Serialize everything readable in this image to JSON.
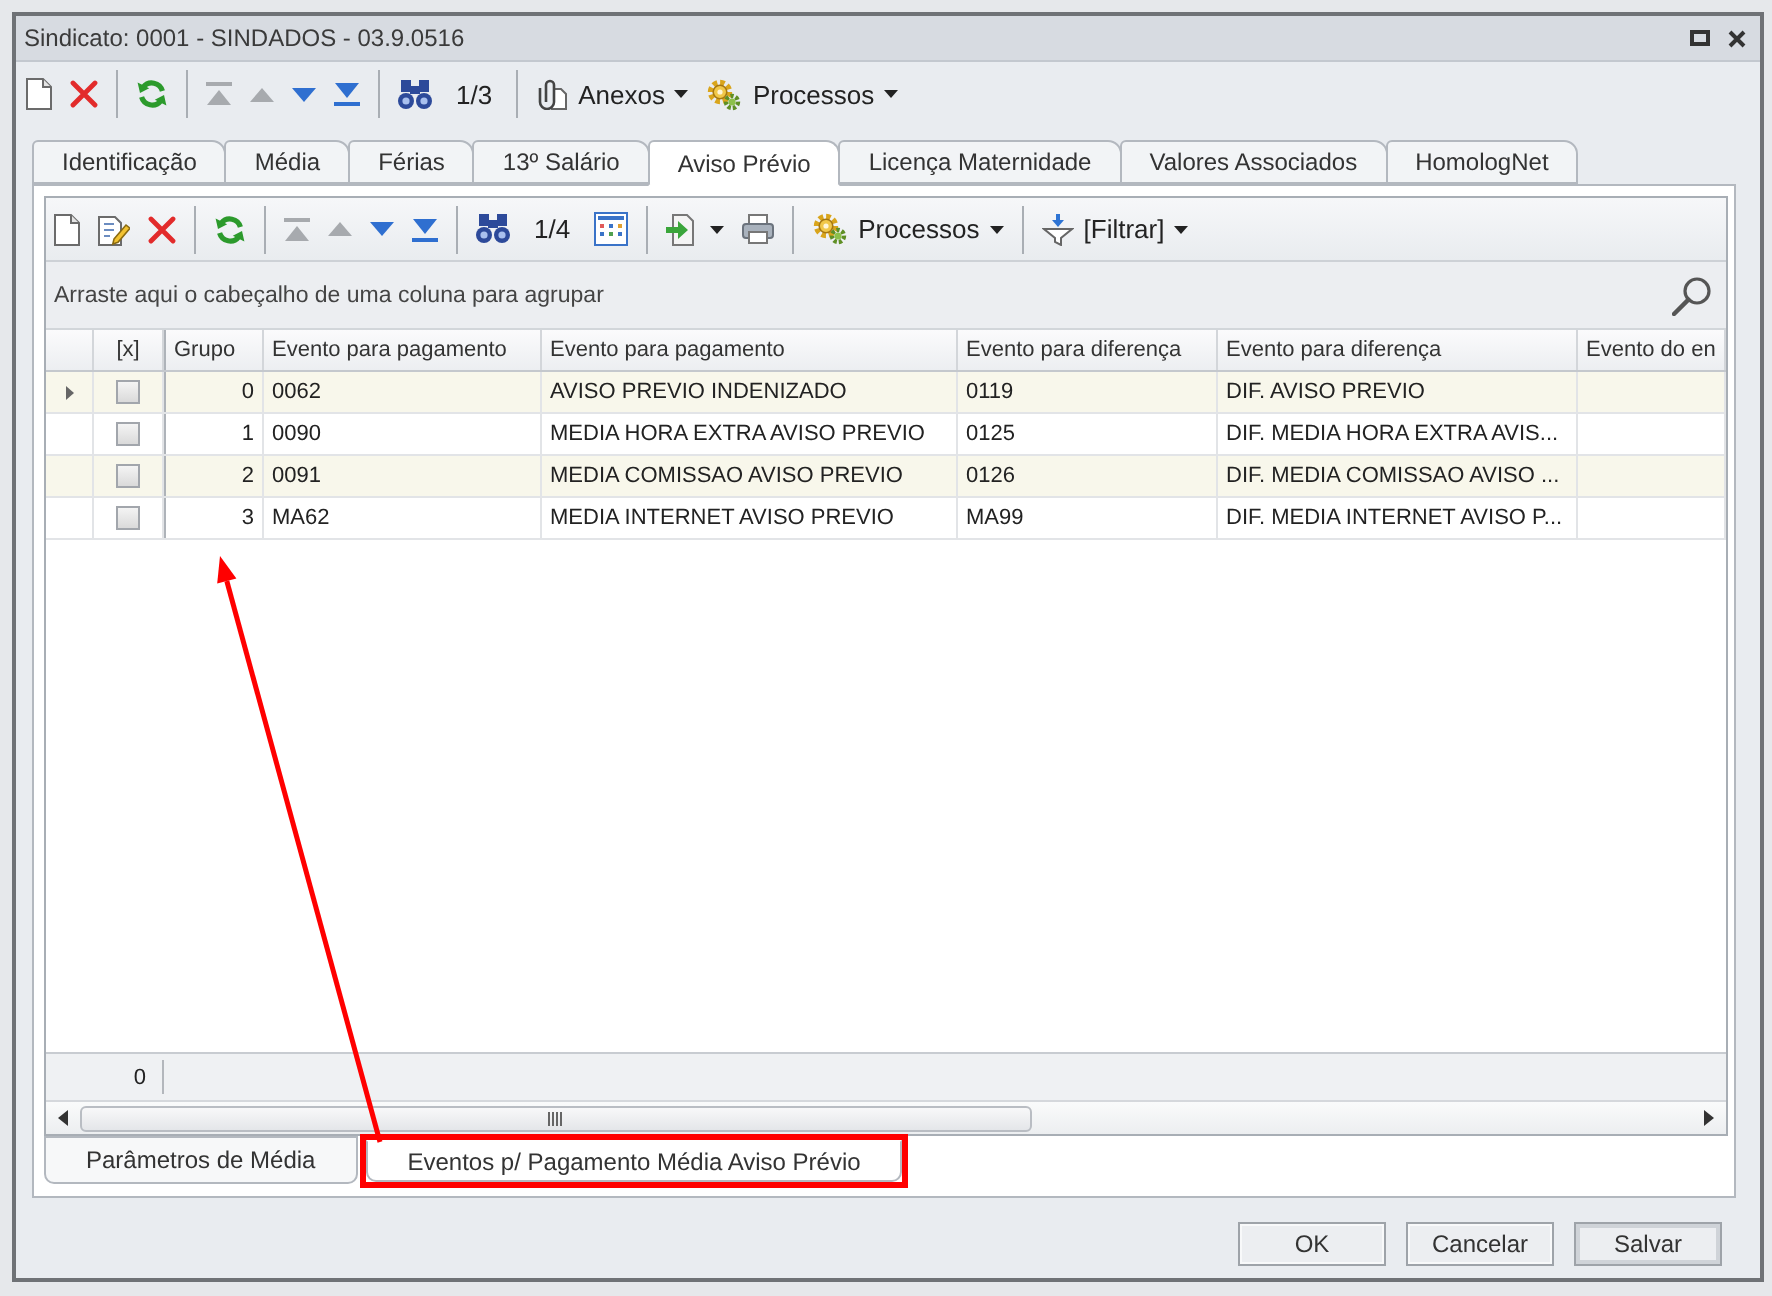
{
  "window": {
    "title": "Sindicato: 0001 - SINDADOS - 03.9.0516"
  },
  "toolbar": {
    "navigation": [
      {
        "disabled": true
      },
      {
        "disabled": true
      },
      {
        "disabled": false
      },
      {
        "disabled": false
      }
    ],
    "record_counter": "1/3",
    "attachments": {
      "label": "Anexos"
    },
    "processes": {
      "label": "Processos"
    }
  },
  "tabs": [
    {
      "label": "Identificação",
      "selected": false
    },
    {
      "label": "Média",
      "selected": false
    },
    {
      "label": "Férias",
      "selected": false
    },
    {
      "label": "13º Salário",
      "selected": false
    },
    {
      "label": "Aviso Prévio",
      "selected": true
    },
    {
      "label": "Licença Maternidade",
      "selected": false
    },
    {
      "label": "Valores Associados",
      "selected": false
    },
    {
      "label": "HomologNet",
      "selected": false
    }
  ],
  "grid_toolbar": {
    "navigation": [
      {
        "disabled": true
      },
      {
        "disabled": true
      },
      {
        "disabled": false
      },
      {
        "disabled": false
      }
    ],
    "record_counter": "1/4",
    "processes": {
      "label": "Processos"
    },
    "filter": {
      "label": "[Filtrar]"
    }
  },
  "group_panel": {
    "hint": "Arraste aqui o cabeçalho de uma coluna para agrupar"
  },
  "table": {
    "check_column": {
      "label": "[x]"
    },
    "columns": [
      {
        "label": "Grupo",
        "kind": "number"
      },
      {
        "label": "Evento para pagamento",
        "kind": "text"
      },
      {
        "label": "Evento para pagamento",
        "kind": "text"
      },
      {
        "label": "Evento para diferença",
        "kind": "text"
      },
      {
        "label": "Evento para diferença",
        "kind": "text"
      },
      {
        "label": "Evento do en",
        "kind": "text"
      }
    ],
    "rows": [
      {
        "selected": true,
        "checked": false,
        "cells": [
          "0",
          "0062",
          "AVISO PREVIO INDENIZADO",
          "0119",
          "DIF. AVISO PREVIO"
        ]
      },
      {
        "selected": false,
        "checked": false,
        "cells": [
          "1",
          "0090",
          "MEDIA HORA EXTRA AVISO PREVIO",
          "0125",
          "DIF. MEDIA HORA EXTRA AVIS..."
        ]
      },
      {
        "selected": false,
        "checked": false,
        "cells": [
          "2",
          "0091",
          "MEDIA COMISSAO AVISO PREVIO",
          "0126",
          "DIF. MEDIA COMISSAO AVISO ..."
        ]
      },
      {
        "selected": false,
        "checked": false,
        "cells": [
          "3",
          "MA62",
          "MEDIA INTERNET AVISO PREVIO",
          "MA99",
          "DIF. MEDIA INTERNET AVISO P..."
        ]
      }
    ],
    "footer": {
      "summary": "0"
    }
  },
  "bottom_tabs": [
    {
      "label": "Parâmetros de Média",
      "selected": false,
      "highlighted": false
    },
    {
      "label": "Eventos p/ Pagamento Média Aviso Prévio",
      "selected": true,
      "highlighted": true
    }
  ],
  "buttons": [
    {
      "label": "OK",
      "default": false
    },
    {
      "label": "Cancelar",
      "default": false
    },
    {
      "label": "Salvar",
      "default": true
    }
  ]
}
